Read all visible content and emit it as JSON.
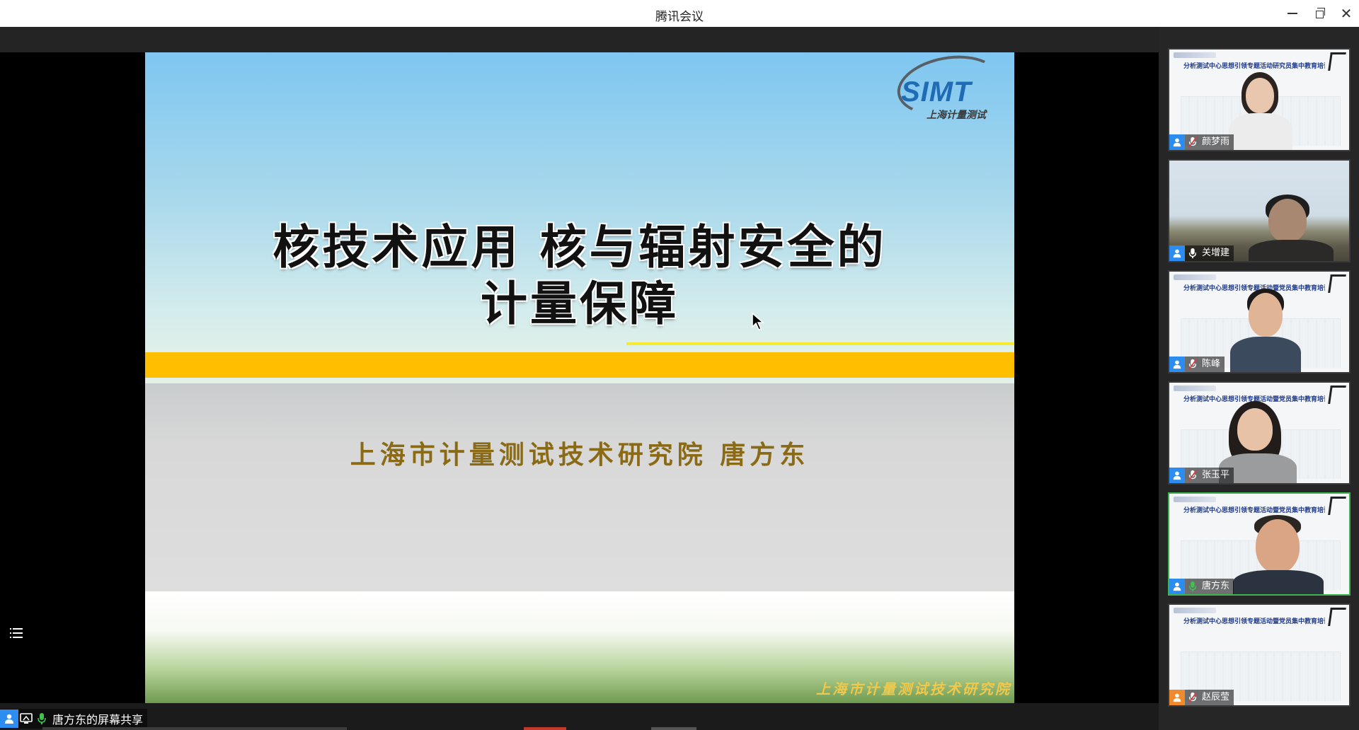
{
  "window": {
    "title": "腾讯会议",
    "controls": {
      "minimize": "minimize-icon",
      "maximize": "restore-icon",
      "close": "close-icon"
    }
  },
  "slide": {
    "logo_text": "SIMT",
    "logo_subtext": "上海计量测试",
    "headline_line1": "核技术应用 核与辐射安全的",
    "headline_line2": "计量保障",
    "author_line": "上海市计量测试技术研究院 唐方东",
    "footer_org": "上海市计量测试技术研究院",
    "colors": {
      "band": "#ffbf00",
      "author": "#8a6a14",
      "footer": "#f2c84a",
      "logo": "#1f6bb5"
    }
  },
  "share_status": {
    "label": "唐方东的屏幕共享",
    "icons": [
      "person-icon",
      "screen-share-icon",
      "mic-icon"
    ]
  },
  "participants": [
    {
      "name": "颜梦雨",
      "muted": true,
      "background": "banner",
      "banner_text": "分析测试中心思想引领专题活动研究员集中教育培训",
      "avatar_color": "#2d8cf0"
    },
    {
      "name": "关增建",
      "muted": false,
      "background": "outdoor",
      "avatar_color": "#2d8cf0"
    },
    {
      "name": "陈峰",
      "muted": true,
      "background": "banner",
      "banner_text": "分析测试中心思想引领专题活动暨党员集中教育培训",
      "avatar_color": "#2d8cf0"
    },
    {
      "name": "张玉平",
      "muted": true,
      "background": "banner",
      "banner_text": "分析测试中心思想引领专题活动暨党员集中教育培训",
      "avatar_color": "#2d8cf0"
    },
    {
      "name": "唐方东",
      "muted": false,
      "speaking": true,
      "background": "banner",
      "banner_text": "分析测试中心思想引领专题活动暨党员集中教育培训",
      "avatar_color": "#2d8cf0"
    },
    {
      "name": "赵辰莹",
      "muted": true,
      "background": "banner",
      "banner_text": "分析测试中心思想引领专题活动暨党员集中教育培训",
      "avatar_color": "#f08a2c"
    }
  ]
}
